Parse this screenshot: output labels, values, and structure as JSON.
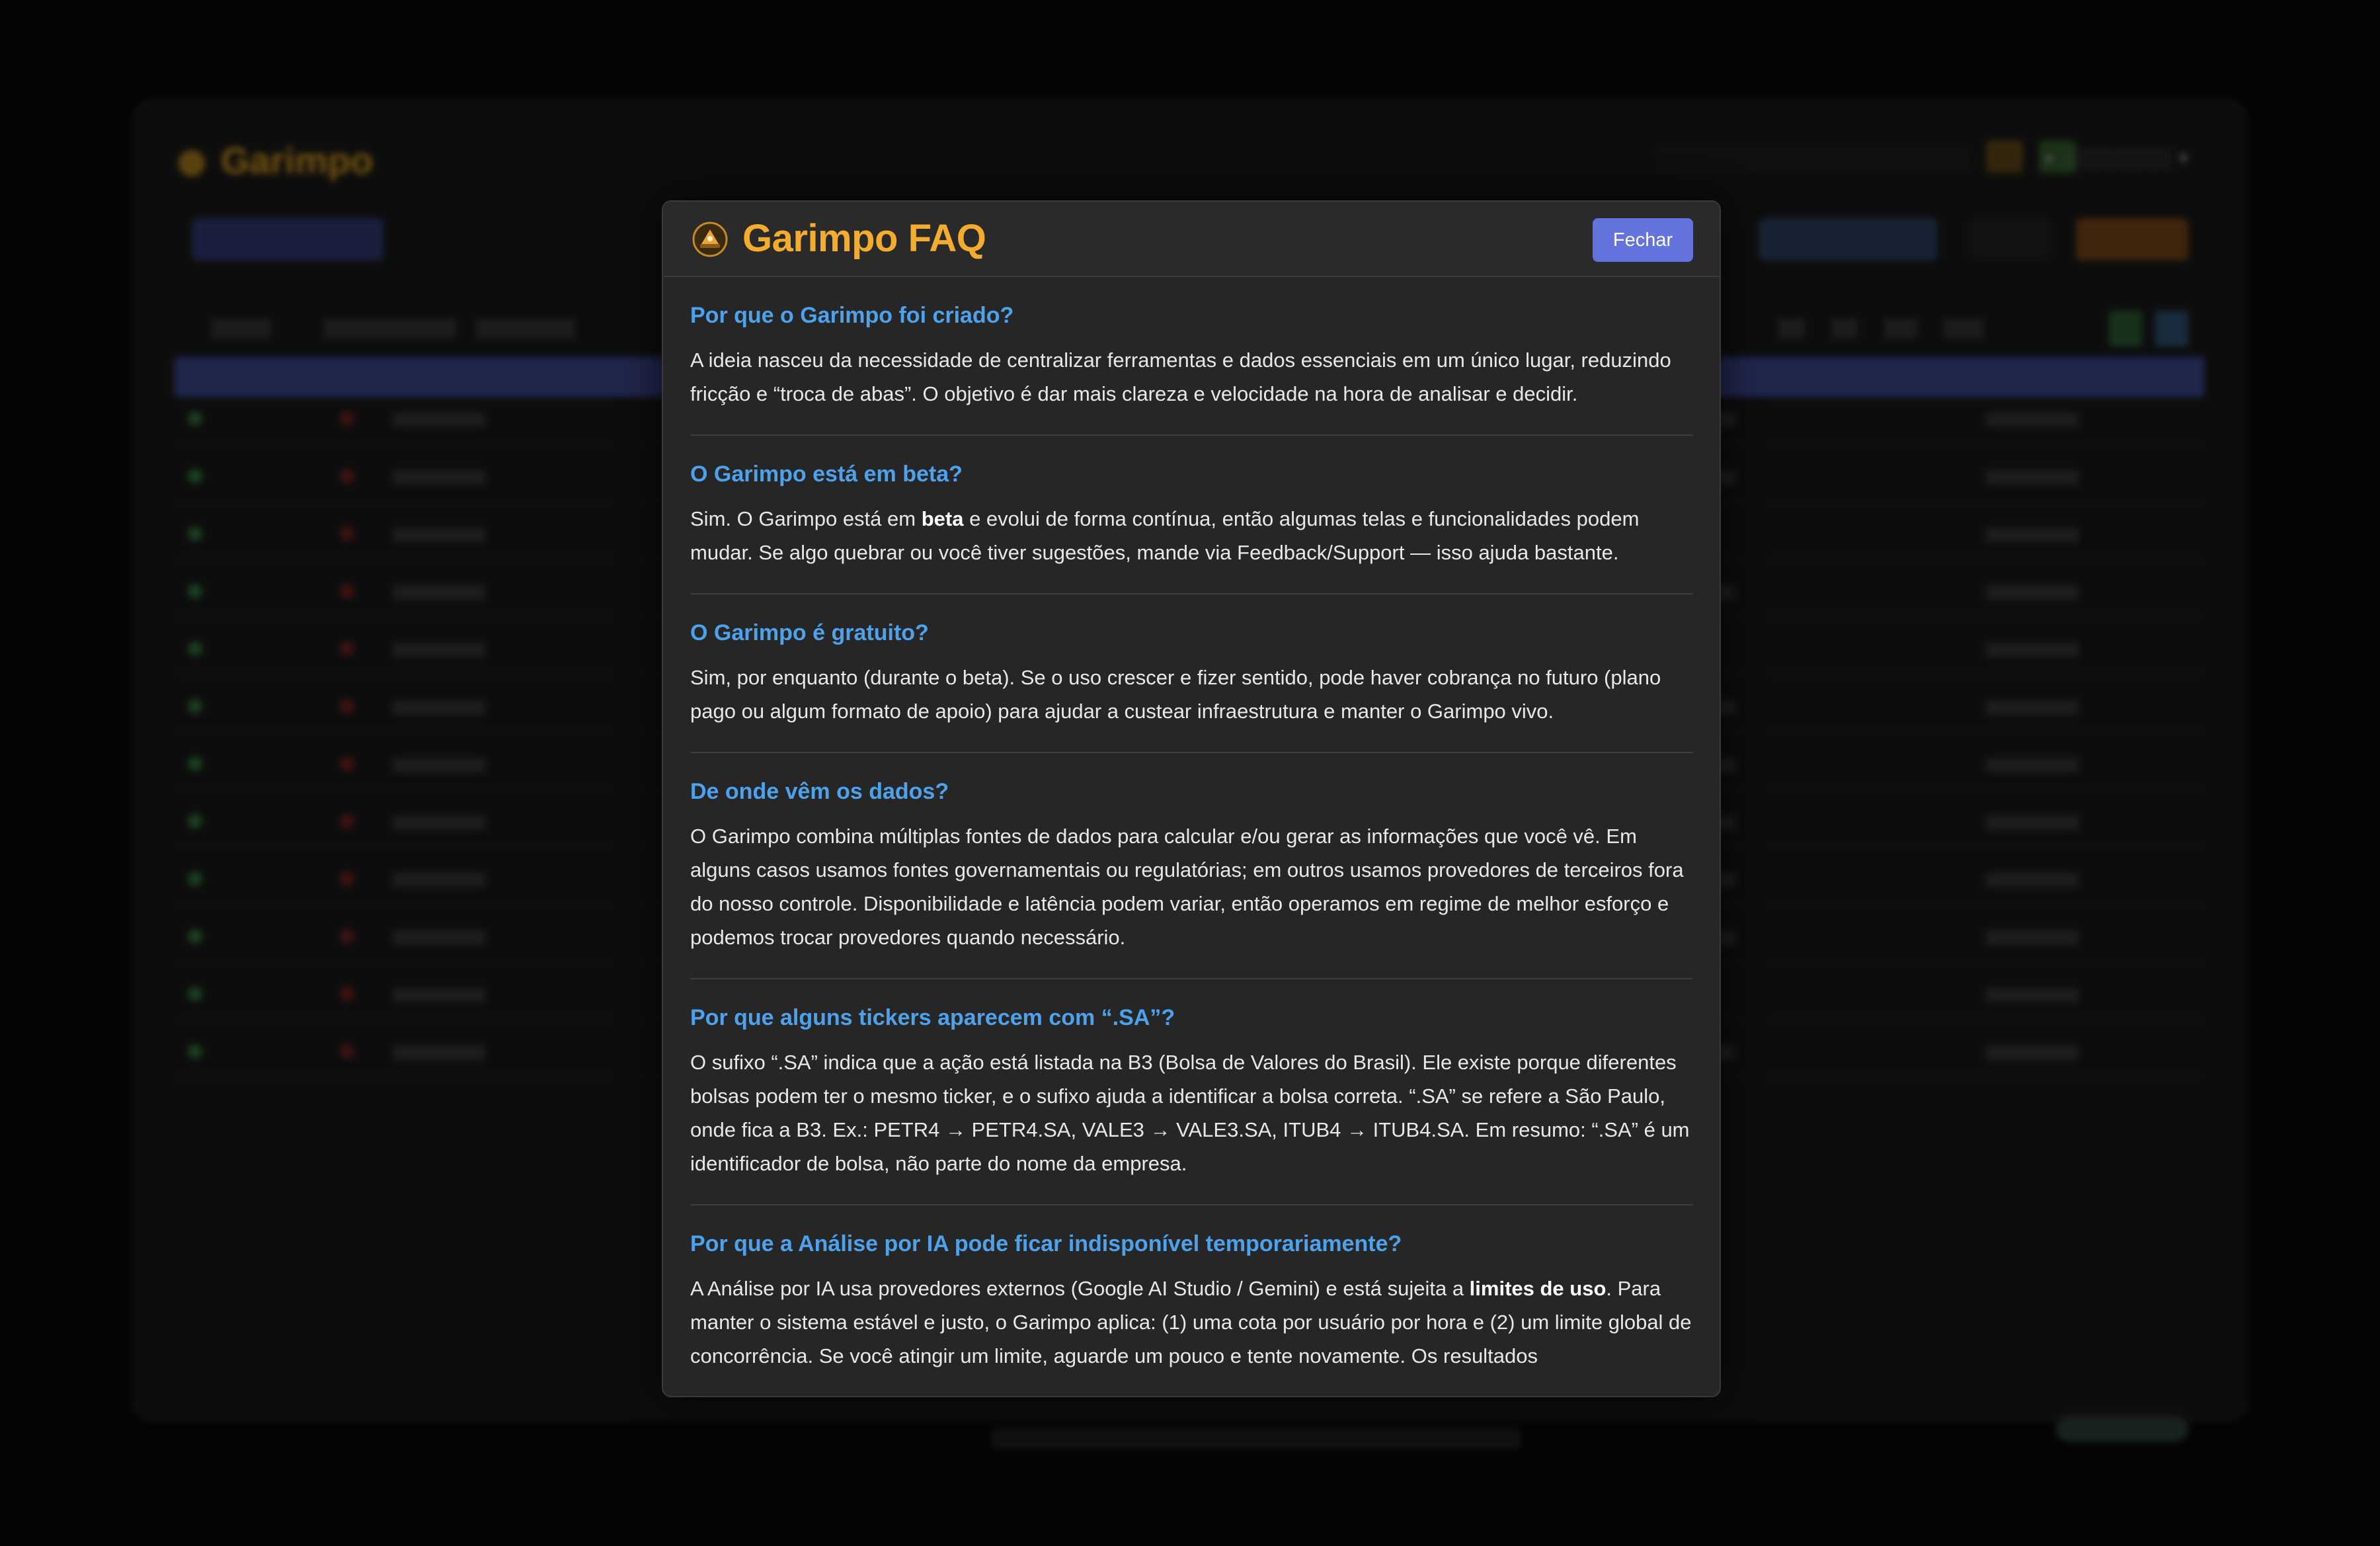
{
  "background_app": {
    "title": "Garimpo"
  },
  "modal": {
    "title": "Garimpo FAQ",
    "close_label": "Fechar",
    "faq": [
      {
        "question": "Por que o Garimpo foi criado?",
        "answer": "A ideia nasceu da necessidade de centralizar ferramentas e dados essenciais em um único lugar, reduzindo fricção e “troca de abas”. O objetivo é dar mais clareza e velocidade na hora de analisar e decidir."
      },
      {
        "question": "O Garimpo está em beta?",
        "answer_pre": "Sim. O Garimpo está em ",
        "answer_bold": "beta",
        "answer_post": " e evolui de forma contínua, então algumas telas e funcionalidades podem mudar. Se algo quebrar ou você tiver sugestões, mande via Feedback/Support — isso ajuda bastante."
      },
      {
        "question": "O Garimpo é gratuito?",
        "answer": "Sim, por enquanto (durante o beta). Se o uso crescer e fizer sentido, pode haver cobrança no futuro (plano pago ou algum formato de apoio) para ajudar a custear infraestrutura e manter o Garimpo vivo."
      },
      {
        "question": "De onde vêm os dados?",
        "answer": "O Garimpo combina múltiplas fontes de dados para calcular e/ou gerar as informações que você vê. Em alguns casos usamos fontes governamentais ou regulatórias; em outros usamos provedores de terceiros fora do nosso controle. Disponibilidade e latência podem variar, então operamos em regime de melhor esforço e podemos trocar provedores quando necessário."
      },
      {
        "question": "Por que alguns tickers aparecem com “.SA”?",
        "answer": "O sufixo “.SA” indica que a ação está listada na B3 (Bolsa de Valores do Brasil). Ele existe porque diferentes bolsas podem ter o mesmo ticker, e o sufixo ajuda a identificar a bolsa correta. “.SA” se refere a São Paulo, onde fica a B3. Ex.: PETR4 → PETR4.SA, VALE3 → VALE3.SA, ITUB4 → ITUB4.SA. Em resumo: “.SA” é um identificador de bolsa, não parte do nome da empresa."
      },
      {
        "question": "Por que a Análise por IA pode ficar indisponível temporariamente?",
        "answer_pre": "A Análise por IA usa provedores externos (Google AI Studio / Gemini) e está sujeita a ",
        "answer_bold": "limites de uso",
        "answer_post": ". Para manter o sistema estável e justo, o Garimpo aplica: (1) uma cota por usuário por hora e (2) um limite global de concorrência. Se você atingir um limite, aguarde um pouco e tente novamente. Os resultados"
      }
    ]
  },
  "colors": {
    "title_gold": "#f4ac2e",
    "question_blue": "#4ea2eb",
    "button_indigo": "#6573de",
    "modal_bg": "#262626"
  },
  "icons": [
    "garimpo-logo-icon"
  ]
}
